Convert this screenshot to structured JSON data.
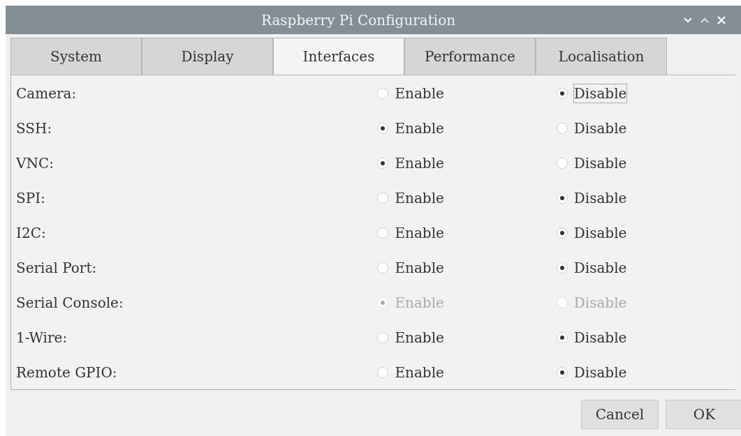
{
  "window": {
    "title": "Raspberry Pi Configuration"
  },
  "tabs": [
    {
      "label": "System",
      "selected": false
    },
    {
      "label": "Display",
      "selected": false
    },
    {
      "label": "Interfaces",
      "selected": true
    },
    {
      "label": "Performance",
      "selected": false
    },
    {
      "label": "Localisation",
      "selected": false
    }
  ],
  "rows": [
    {
      "label": "Camera:",
      "disabled": false,
      "options": [
        {
          "label": "Enable",
          "selected": false,
          "focused": false
        },
        {
          "label": "Disable",
          "selected": true,
          "focused": true
        }
      ]
    },
    {
      "label": "SSH:",
      "disabled": false,
      "options": [
        {
          "label": "Enable",
          "selected": true,
          "focused": false
        },
        {
          "label": "Disable",
          "selected": false,
          "focused": false
        }
      ]
    },
    {
      "label": "VNC:",
      "disabled": false,
      "options": [
        {
          "label": "Enable",
          "selected": true,
          "focused": false
        },
        {
          "label": "Disable",
          "selected": false,
          "focused": false
        }
      ]
    },
    {
      "label": "SPI:",
      "disabled": false,
      "options": [
        {
          "label": "Enable",
          "selected": false,
          "focused": false
        },
        {
          "label": "Disable",
          "selected": true,
          "focused": false
        }
      ]
    },
    {
      "label": "I2C:",
      "disabled": false,
      "options": [
        {
          "label": "Enable",
          "selected": false,
          "focused": false
        },
        {
          "label": "Disable",
          "selected": true,
          "focused": false
        }
      ]
    },
    {
      "label": "Serial Port:",
      "disabled": false,
      "options": [
        {
          "label": "Enable",
          "selected": false,
          "focused": false
        },
        {
          "label": "Disable",
          "selected": true,
          "focused": false
        }
      ]
    },
    {
      "label": "Serial Console:",
      "disabled": true,
      "options": [
        {
          "label": "Enable",
          "selected": true,
          "focused": false
        },
        {
          "label": "Disable",
          "selected": false,
          "focused": false
        }
      ]
    },
    {
      "label": "1-Wire:",
      "disabled": false,
      "options": [
        {
          "label": "Enable",
          "selected": false,
          "focused": false
        },
        {
          "label": "Disable",
          "selected": true,
          "focused": false
        }
      ]
    },
    {
      "label": "Remote GPIO:",
      "disabled": false,
      "options": [
        {
          "label": "Enable",
          "selected": false,
          "focused": false
        },
        {
          "label": "Disable",
          "selected": true,
          "focused": false
        }
      ]
    }
  ],
  "buttons": [
    "Cancel",
    "OK"
  ]
}
